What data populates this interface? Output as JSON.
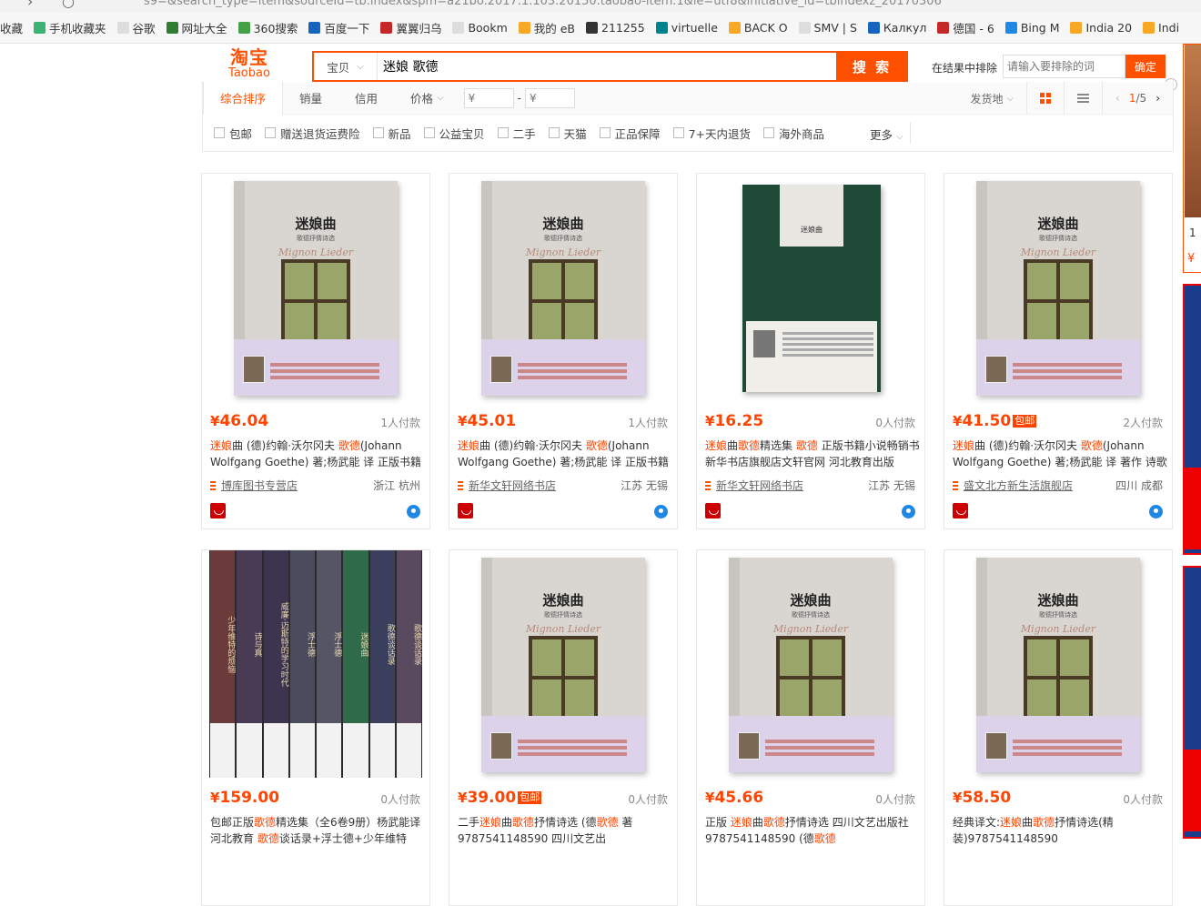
{
  "browser": {
    "url_fragment": "s9=&search_type=item&sourceId=tb.index&spm=a21bo.2017.1.103.20150.taobao-item.1&ie=utf8&initiative_id=tbindexz_20170306"
  },
  "bookmarks": [
    {
      "label": "收藏",
      "color": "#ffffff"
    },
    {
      "label": "手机收藏夹",
      "color": "#3cb371"
    },
    {
      "label": "谷歌",
      "color": "#dddddd"
    },
    {
      "label": "网址大全",
      "color": "#2e7d32"
    },
    {
      "label": "360搜索",
      "color": "#43a047"
    },
    {
      "label": "百度一下",
      "color": "#1565c0"
    },
    {
      "label": "翼翼归乌",
      "color": "#c62828"
    },
    {
      "label": "Bookm",
      "color": "#dddddd"
    },
    {
      "label": "我的 eB",
      "color": "#f9a825"
    },
    {
      "label": "211255",
      "color": "#333333"
    },
    {
      "label": "virtuelle",
      "color": "#00838f"
    },
    {
      "label": "BACK O",
      "color": "#f9a825"
    },
    {
      "label": "SMV | S",
      "color": "#dddddd"
    },
    {
      "label": "Калкул",
      "color": "#1565c0"
    },
    {
      "label": "德国 - 6",
      "color": "#c62828"
    },
    {
      "label": "Bing M",
      "color": "#1e88e5"
    },
    {
      "label": "India 20",
      "color": "#f9a825"
    },
    {
      "label": "Indi",
      "color": "#f9a825"
    }
  ],
  "header": {
    "logo_cn": "淘宝",
    "logo_en": "Taobao",
    "search_type": "宝贝",
    "search_query": "迷娘 歌德",
    "search_button": "搜 索",
    "exclude_label": "在结果中排除",
    "exclude_placeholder": "请输入要排除的词",
    "exclude_button": "确定",
    "close": "×"
  },
  "sort": {
    "items": [
      "综合排序",
      "销量",
      "信用",
      "价格"
    ],
    "price_from": "¥",
    "price_to": "¥",
    "price_dash": "-",
    "ship_from": "发货地",
    "page": "1",
    "page_total": "/5"
  },
  "filters": [
    "包邮",
    "赠送退货运费险",
    "新品",
    "公益宝贝",
    "二手",
    "天猫",
    "正品保障",
    "7+天内退货",
    "海外商品"
  ],
  "more": "更多",
  "products": [
    {
      "price": "46.04",
      "baoyou": "",
      "sold": "1人付款",
      "title_parts": [
        {
          "t": "迷娘",
          "hl": true
        },
        {
          "t": "曲 (德)约翰·沃尔冈夫 ",
          "hl": false
        },
        {
          "t": "歌德",
          "hl": true
        },
        {
          "t": "(Johann Wolfgang Goethe) 著;杨武能 译 正版书籍",
          "hl": false
        }
      ],
      "shop": "博库图书专营店",
      "loc": "浙江 杭州"
    },
    {
      "price": "45.01",
      "baoyou": "",
      "sold": "1人付款",
      "title_parts": [
        {
          "t": "迷娘",
          "hl": true
        },
        {
          "t": "曲 (德)约翰·沃尔冈夫 ",
          "hl": false
        },
        {
          "t": "歌德",
          "hl": true
        },
        {
          "t": "(Johann Wolfgang Goethe) 著;杨武能 译 正版书籍",
          "hl": false
        }
      ],
      "shop": "新华文轩网络书店",
      "loc": "江苏 无锡"
    },
    {
      "price": "16.25",
      "baoyou": "",
      "sold": "0人付款",
      "title_parts": [
        {
          "t": "迷娘",
          "hl": true
        },
        {
          "t": "曲",
          "hl": false
        },
        {
          "t": "歌德",
          "hl": true
        },
        {
          "t": "精选集 ",
          "hl": false
        },
        {
          "t": "歌德",
          "hl": true
        },
        {
          "t": " 正版书籍小说畅销书 新华书店旗舰店文轩官网 河北教育出版",
          "hl": false
        }
      ],
      "shop": "新华文轩网络书店",
      "loc": "江苏 无锡"
    },
    {
      "price": "41.50",
      "baoyou": "包邮",
      "sold": "2人付款",
      "title_parts": [
        {
          "t": "迷娘",
          "hl": true
        },
        {
          "t": "曲 (德)约翰·沃尔冈夫 ",
          "hl": false
        },
        {
          "t": "歌德",
          "hl": true
        },
        {
          "t": "(Johann Wolfgang Goethe) 著;杨武能 译 著作 诗歌",
          "hl": false
        }
      ],
      "shop": "盛文北方新生活旗舰店",
      "loc": "四川 成都"
    },
    {
      "price": "159.00",
      "baoyou": "",
      "sold": "0人付款",
      "title_parts": [
        {
          "t": "包邮正版",
          "hl": false
        },
        {
          "t": "歌德",
          "hl": true
        },
        {
          "t": "精选集（全6卷9册）杨武能译 河北教育 ",
          "hl": false
        },
        {
          "t": "歌德",
          "hl": true
        },
        {
          "t": "谈话录+浮士德+少年维特",
          "hl": false
        }
      ],
      "shop": "",
      "loc": ""
    },
    {
      "price": "39.00",
      "baoyou": "包邮",
      "sold": "0人付款",
      "title_parts": [
        {
          "t": "二手",
          "hl": false
        },
        {
          "t": "迷娘",
          "hl": true
        },
        {
          "t": "曲",
          "hl": false
        },
        {
          "t": "歌德",
          "hl": true
        },
        {
          "t": "抒情诗选 (德",
          "hl": false
        },
        {
          "t": "歌德",
          "hl": true
        },
        {
          "t": " 著 9787541148590 四川文艺出",
          "hl": false
        }
      ],
      "shop": "",
      "loc": ""
    },
    {
      "price": "45.66",
      "baoyou": "",
      "sold": "0人付款",
      "title_parts": [
        {
          "t": "正版 ",
          "hl": false
        },
        {
          "t": "迷娘",
          "hl": true
        },
        {
          "t": "曲",
          "hl": false
        },
        {
          "t": "歌德",
          "hl": true
        },
        {
          "t": "抒情诗选 四川文艺出版社 9787541148590 (德",
          "hl": false
        },
        {
          "t": "歌德",
          "hl": true
        }
      ],
      "shop": "",
      "loc": ""
    },
    {
      "price": "58.50",
      "baoyou": "",
      "sold": "0人付款",
      "title_parts": [
        {
          "t": "经典译文:",
          "hl": false
        },
        {
          "t": "迷娘",
          "hl": true
        },
        {
          "t": "曲",
          "hl": false
        },
        {
          "t": "歌德",
          "hl": true
        },
        {
          "t": "抒情诗选(精装)9787541148590",
          "hl": false
        }
      ],
      "shop": "",
      "loc": ""
    }
  ],
  "book_cover": {
    "title": "迷娘曲",
    "subtitle": "歌德抒情诗选",
    "script": "Mignon Lieder"
  },
  "dark_book": {
    "title": "迷娘曲"
  },
  "shelf_volumes": [
    "少年维特的烦恼",
    "诗与真",
    "威廉·迈斯特的学习时代",
    "浮士德",
    "浮士德",
    "迷娘曲",
    "歌德谈话录",
    "歌德谈话录"
  ],
  "ad": {
    "n": "1",
    "price": "¥"
  },
  "colors": {
    "accent": "#ff5000",
    "price": "#ff4400"
  }
}
